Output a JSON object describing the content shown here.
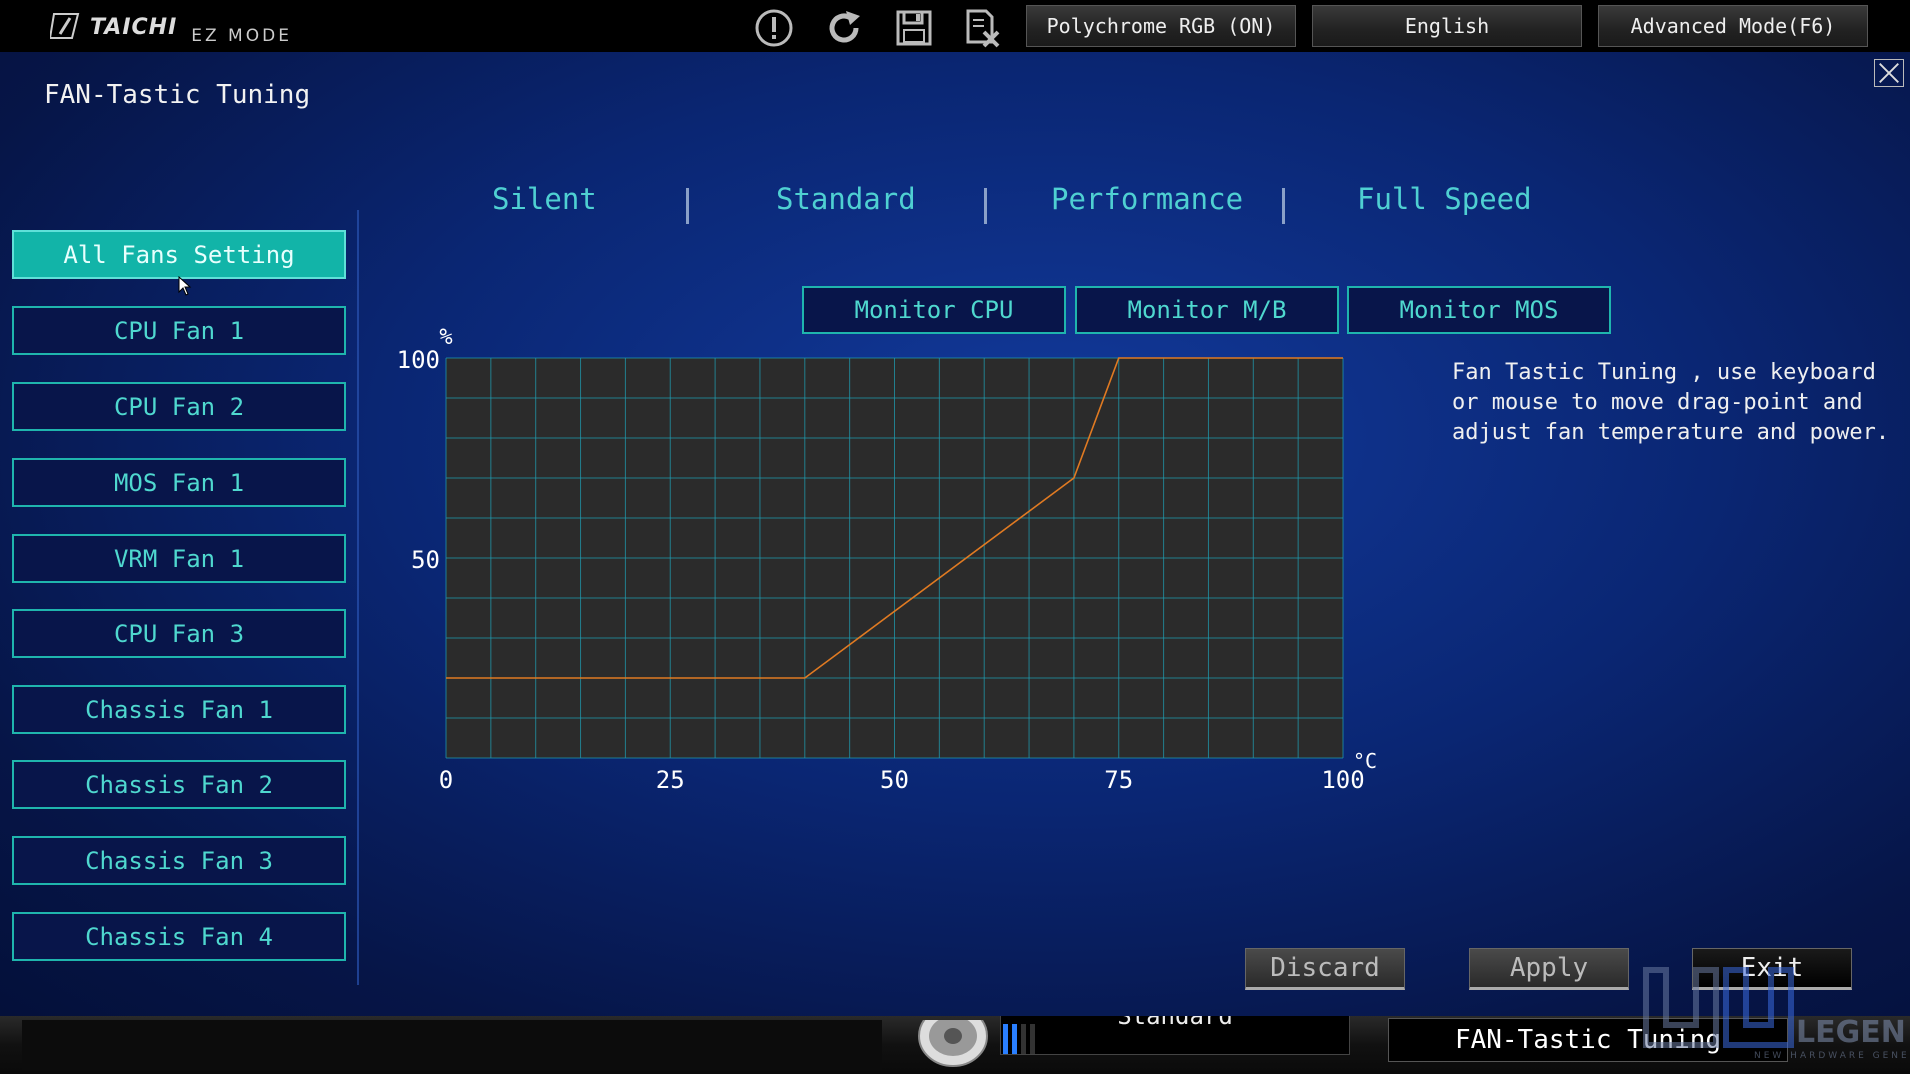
{
  "topbar": {
    "brand_name": "TAICHI",
    "brand_mode": "EZ MODE",
    "polychrome_label": "Polychrome RGB (ON)",
    "language_label": "English",
    "advanced_label": "Advanced Mode(F6)",
    "icons": [
      "alert-icon",
      "refresh-icon",
      "save-icon",
      "discard-file-icon"
    ]
  },
  "page": {
    "title": "FAN-Tastic Tuning"
  },
  "sidebar": {
    "items": [
      {
        "label": "All Fans Setting",
        "active": true
      },
      {
        "label": "CPU Fan 1"
      },
      {
        "label": "CPU Fan 2"
      },
      {
        "label": "MOS Fan 1"
      },
      {
        "label": "VRM Fan 1"
      },
      {
        "label": "CPU Fan 3"
      },
      {
        "label": "Chassis Fan 1"
      },
      {
        "label": "Chassis Fan 2"
      },
      {
        "label": "Chassis Fan 3"
      },
      {
        "label": "Chassis Fan 4"
      }
    ]
  },
  "modes": [
    "Silent",
    "Standard",
    "Performance",
    "Full Speed"
  ],
  "monitors": [
    "Monitor CPU",
    "Monitor M/B",
    "Monitor MOS"
  ],
  "help": {
    "lines": [
      "Fan Tastic Tuning , use keyboard",
      "or mouse to move drag-point and",
      "adjust fan temperature and power."
    ]
  },
  "chart_data": {
    "type": "line",
    "xlabel": "°C",
    "ylabel": "%",
    "xlim": [
      0,
      100
    ],
    "ylim": [
      0,
      100
    ],
    "x_ticks": [
      "0",
      "25",
      "50",
      "75",
      "100"
    ],
    "y_ticks": [
      "100",
      "50"
    ],
    "grid": true,
    "series": [
      {
        "x": [
          0,
          40,
          70,
          75,
          100
        ],
        "y": [
          20,
          20,
          70,
          100,
          100
        ],
        "color": "#e07a22"
      }
    ]
  },
  "actions": {
    "discard": "Discard",
    "apply": "Apply",
    "exit": "Exit"
  },
  "bottom": {
    "profile": "Standard",
    "feature": "FAN-Tastic Tuning"
  },
  "watermark": {
    "text": "LEGEND",
    "sub": "NEW HARDWARE GENERATION"
  },
  "colors": {
    "accent": "#1fb5ad",
    "active": "#12b4a8",
    "curve": "#e07a22",
    "plot_bg": "#2b2b2b"
  }
}
